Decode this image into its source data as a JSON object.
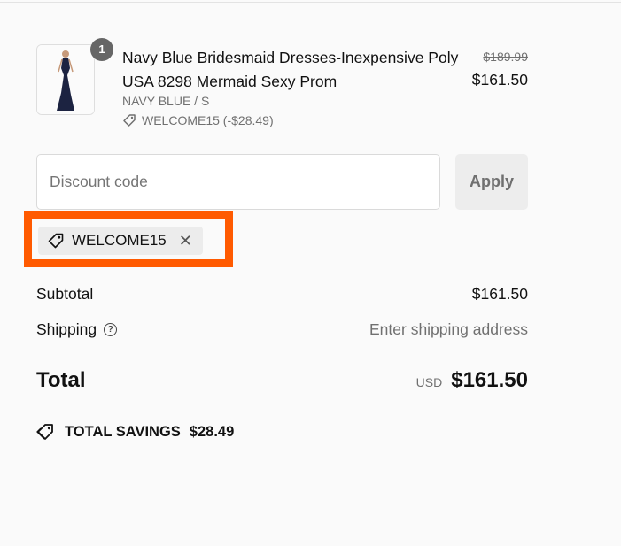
{
  "product": {
    "quantity": "1",
    "title": "Navy Blue Bridesmaid Dresses-Inexpensive Poly USA 8298 Mermaid Sexy Prom",
    "variant": "NAVY BLUE / S",
    "applied_discount": "WELCOME15 (-$28.49)",
    "original_price": "$189.99",
    "price": "$161.50",
    "image_icon": "dress-thumbnail"
  },
  "discount": {
    "placeholder": "Discount code",
    "apply_label": "Apply",
    "applied_code": "WELCOME15"
  },
  "summary": {
    "subtotal_label": "Subtotal",
    "subtotal_value": "$161.50",
    "shipping_label": "Shipping",
    "shipping_value": "Enter shipping address",
    "total_label": "Total",
    "currency": "USD",
    "total_value": "$161.50",
    "savings_label": "TOTAL SAVINGS",
    "savings_value": "$28.49"
  },
  "colors": {
    "highlight": "#ff5a00",
    "chip_bg": "#ececec"
  }
}
